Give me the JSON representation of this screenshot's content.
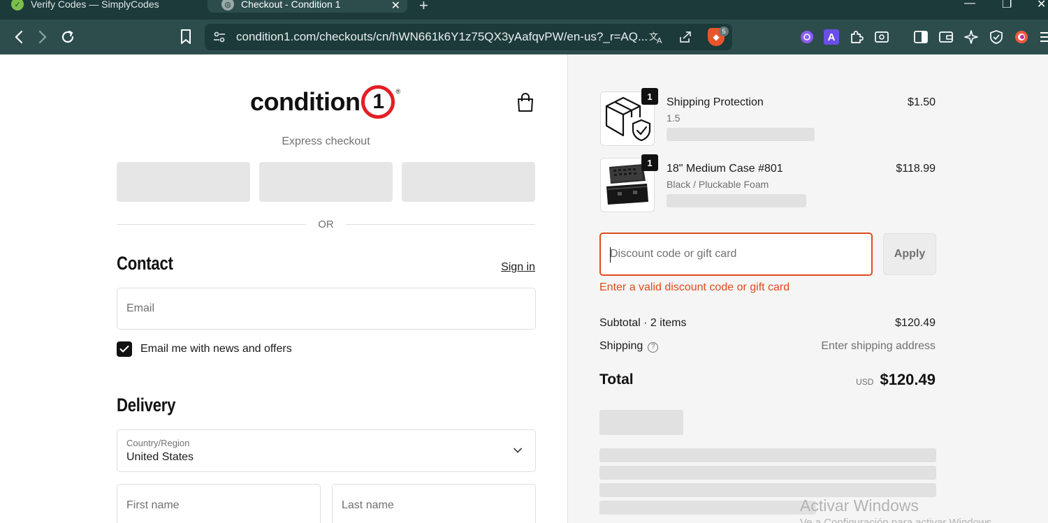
{
  "browser": {
    "tabs": [
      {
        "title": "Verify Codes — SimplyCodes",
        "active": false
      },
      {
        "title": "Checkout - Condition 1",
        "active": true
      }
    ],
    "url": "condition1.com/checkouts/cn/hWN661k6Y1z75QX3yAafqvPW/en-us?_r=AQ...",
    "brave_badge": "5",
    "ext_a_label": "A"
  },
  "header": {
    "logo_text": "condition",
    "logo_number": "1",
    "logo_reg": "®"
  },
  "express": {
    "label": "Express checkout",
    "or_text": "OR"
  },
  "contact": {
    "title": "Contact",
    "sign_in": "Sign in",
    "email_placeholder": "Email",
    "newsletter_label": "Email me with news and offers",
    "newsletter_checked": true
  },
  "delivery": {
    "title": "Delivery",
    "country_label": "Country/Region",
    "country_value": "United States",
    "first_name_placeholder": "First name",
    "last_name_placeholder": "Last name"
  },
  "order": {
    "items": [
      {
        "name": "Shipping Protection",
        "variant": "1.5",
        "price": "$1.50",
        "quantity": "1"
      },
      {
        "name": "18\" Medium Case #801",
        "variant": "Black / Pluckable Foam",
        "price": "$118.99",
        "quantity": "1"
      }
    ],
    "discount_placeholder": "Discount code or gift card",
    "apply_label": "Apply",
    "discount_error": "Enter a valid discount code or gift card",
    "subtotal_label": "Subtotal · 2 items",
    "subtotal_value": "$120.49",
    "shipping_label": "Shipping",
    "shipping_value": "Enter shipping address",
    "total_label": "Total",
    "total_currency": "USD",
    "total_value": "$120.49"
  },
  "os": {
    "watermark": "Activar Windows",
    "watermark_sub": "Ve a Configuración para activar Windows."
  },
  "colors": {
    "error": "#dd4c1c",
    "brand_red": "#e31e24",
    "chrome_bg": "#2d4d4d"
  }
}
